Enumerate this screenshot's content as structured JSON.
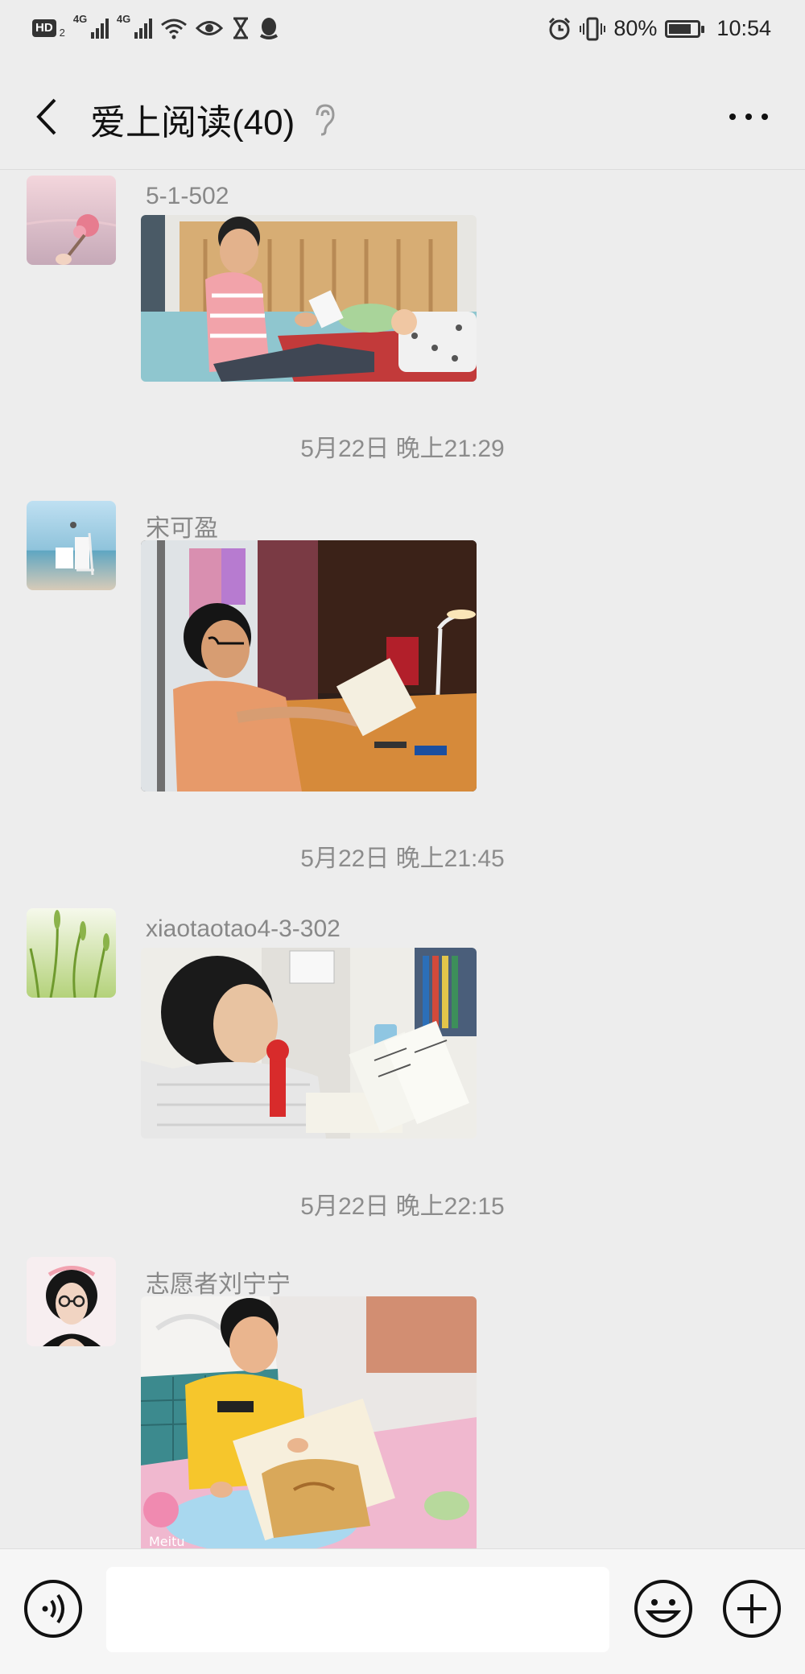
{
  "status_bar": {
    "hd_label": "HD",
    "hd_sub": "2",
    "network_1": "4G",
    "network_2": "4G",
    "battery_percent_label": "80%",
    "battery_level": 0.8,
    "time": "10:54"
  },
  "nav": {
    "title": "爱上阅读(40)",
    "back_icon": "chevron-left-icon",
    "earpiece_icon": "ear-icon",
    "more_icon": "more-dots-icon"
  },
  "messages": [
    {
      "sender": "5-1-502",
      "photo": "child reading book on bed next to sleeping baby"
    },
    {
      "timestamp": "5月22日 晚上21:29"
    },
    {
      "sender": "宋可盈",
      "photo": "girl with glasses reading at desk under lamp"
    },
    {
      "timestamp": "5月22日 晚上21:45"
    },
    {
      "sender": "xiaotaotao4-3-302",
      "photo": "girl reading picture book at desk"
    },
    {
      "timestamp": "5月22日 晚上22:15"
    },
    {
      "sender": "志愿者刘宁宁",
      "photo": "boy reading picture book on bed"
    }
  ],
  "colors": {
    "background": "#ededed",
    "input_bar": "#f6f6f6",
    "timestamp_text": "#8c8c8c",
    "sender_text": "#888888"
  },
  "input_bar": {
    "voice_icon": "voice-icon",
    "emoji_icon": "emoji-icon",
    "plus_icon": "plus-circle-icon",
    "text_value": ""
  }
}
